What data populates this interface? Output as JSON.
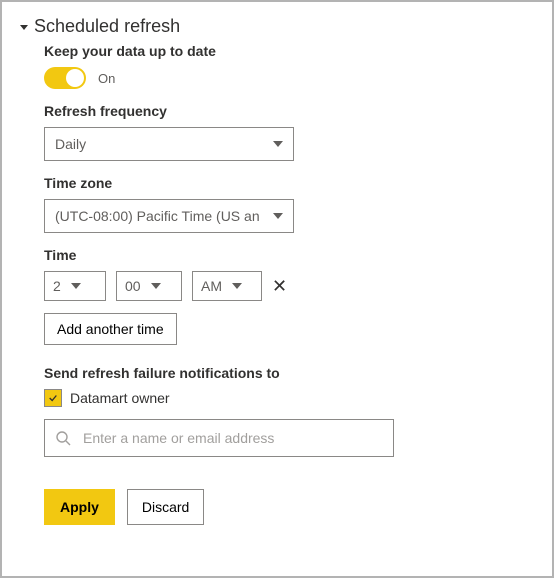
{
  "section": {
    "title": "Scheduled refresh"
  },
  "keep_up_to_date": {
    "label": "Keep your data up to date",
    "status": "On"
  },
  "frequency": {
    "label": "Refresh frequency",
    "value": "Daily"
  },
  "timezone": {
    "label": "Time zone",
    "value": "(UTC-08:00) Pacific Time (US an"
  },
  "time": {
    "label": "Time",
    "hour": "2",
    "minute": "00",
    "ampm": "AM",
    "add_label": "Add another time"
  },
  "notifications": {
    "label": "Send refresh failure notifications to",
    "owner_label": "Datamart owner",
    "placeholder": "Enter a name or email address"
  },
  "actions": {
    "apply": "Apply",
    "discard": "Discard"
  }
}
